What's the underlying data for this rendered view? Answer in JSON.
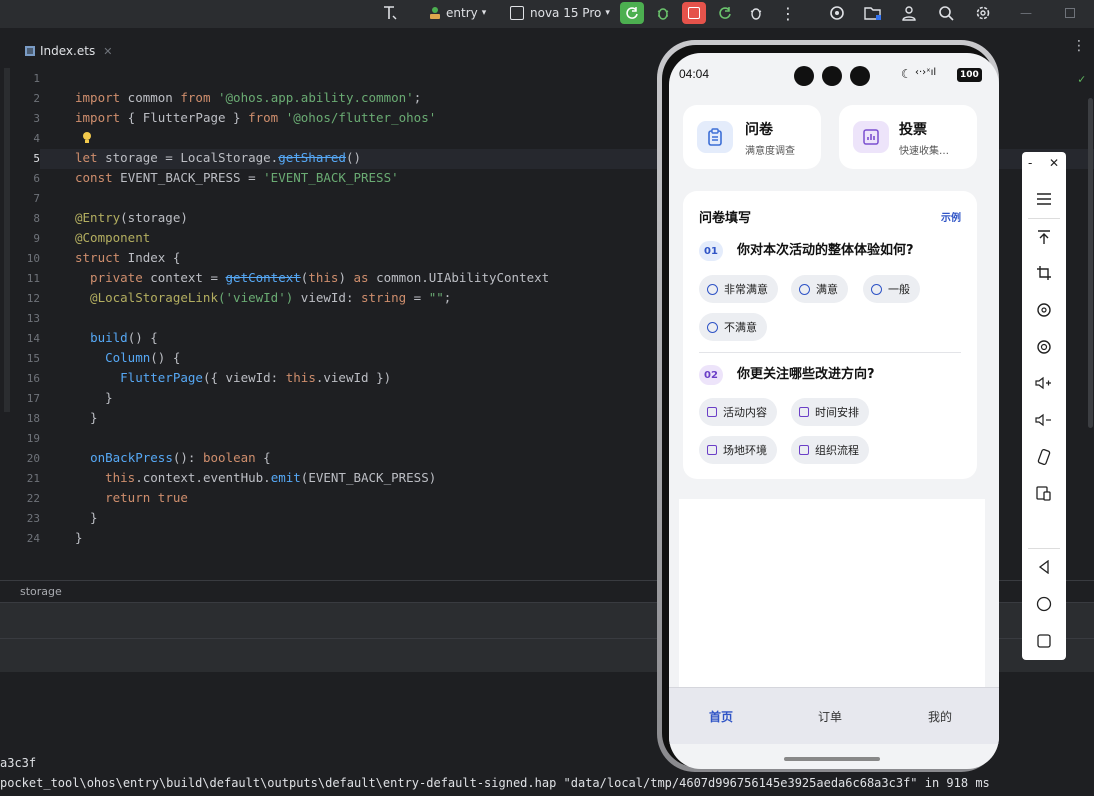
{
  "toolbar": {
    "module": "entry",
    "device": "nova 15 Pro",
    "colors": {
      "run_green": "#4caf50",
      "stop_red": "#e5534b"
    }
  },
  "editor": {
    "tab_label": "Index.ets",
    "breadcrumb": "storage",
    "line_numbers": [
      "1",
      "2",
      "3",
      "4",
      "5",
      "6",
      "7",
      "8",
      "9",
      "10",
      "11",
      "12",
      "13",
      "14",
      "15",
      "16",
      "17",
      "18",
      "19",
      "20",
      "21",
      "22",
      "23",
      "24"
    ],
    "code": {
      "l2": [
        "import",
        " common ",
        "from",
        " '@ohos.app.ability.common'",
        ";"
      ],
      "l3": [
        "import",
        " { FlutterPage } ",
        "from",
        " '@ohos/flutter_ohos'"
      ],
      "l5": [
        "let",
        " storage = LocalStorage.",
        "getShared",
        "()"
      ],
      "l6": [
        "const",
        " EVENT_BACK_PRESS = ",
        "'EVENT_BACK_PRESS'"
      ],
      "l8": [
        "@Entry",
        "(storage)"
      ],
      "l9": [
        "@Component"
      ],
      "l10": [
        "struct",
        " Index {"
      ],
      "l11": [
        "  private",
        " context = ",
        "getContext",
        "(",
        "this",
        ") ",
        "as",
        " common.UIAbilityContext"
      ],
      "l12": [
        "  @LocalStorageLink",
        "('viewId')",
        " viewId: ",
        "string",
        " = ",
        "\"\"",
        ";"
      ],
      "l14": [
        "  ",
        "build",
        "() {"
      ],
      "l15": [
        "    ",
        "Column",
        "() {"
      ],
      "l16": [
        "      ",
        "FlutterPage",
        "({ viewId: ",
        "this",
        ".viewId })"
      ],
      "l17": [
        "    }"
      ],
      "l18": [
        "  }"
      ],
      "l20": [
        "  ",
        "onBackPress",
        "(): ",
        "boolean",
        " {"
      ],
      "l21": [
        "    ",
        "this",
        ".context.eventHub.",
        "emit",
        "(EVENT_BACK_PRESS)"
      ],
      "l22": [
        "    ",
        "return",
        " ",
        "true"
      ],
      "l23": [
        "  }"
      ],
      "l24": [
        "}"
      ]
    }
  },
  "console": {
    "line1": "a3c3f",
    "line2": "pocket_tool\\ohos\\entry\\build\\default\\outputs\\default\\entry-default-signed.hap \"data/local/tmp/4607d996756145e3925aeda6c68a3c3f\" in 918 ms"
  },
  "phone": {
    "time": "04:04",
    "battery": "100",
    "cards": [
      {
        "title": "问卷",
        "subtitle": "满意度调查",
        "icon": "clipboard-icon",
        "color": "#3d6fd6"
      },
      {
        "title": "投票",
        "subtitle": "快速收集…",
        "icon": "bar-chart-icon",
        "color": "#7b4fd0"
      }
    ],
    "survey": {
      "title": "问卷填写",
      "example_link": "示例",
      "q1": {
        "num": "01",
        "text": "你对本次活动的整体体验如何?",
        "options": [
          "非常满意",
          "满意",
          "一般",
          "不满意"
        ]
      },
      "q2": {
        "num": "02",
        "text": "你更关注哪些改进方向?",
        "options": [
          "活动内容",
          "时间安排",
          "场地环境",
          "组织流程"
        ]
      }
    },
    "bottom_nav": [
      "首页",
      "订单",
      "我的"
    ]
  }
}
